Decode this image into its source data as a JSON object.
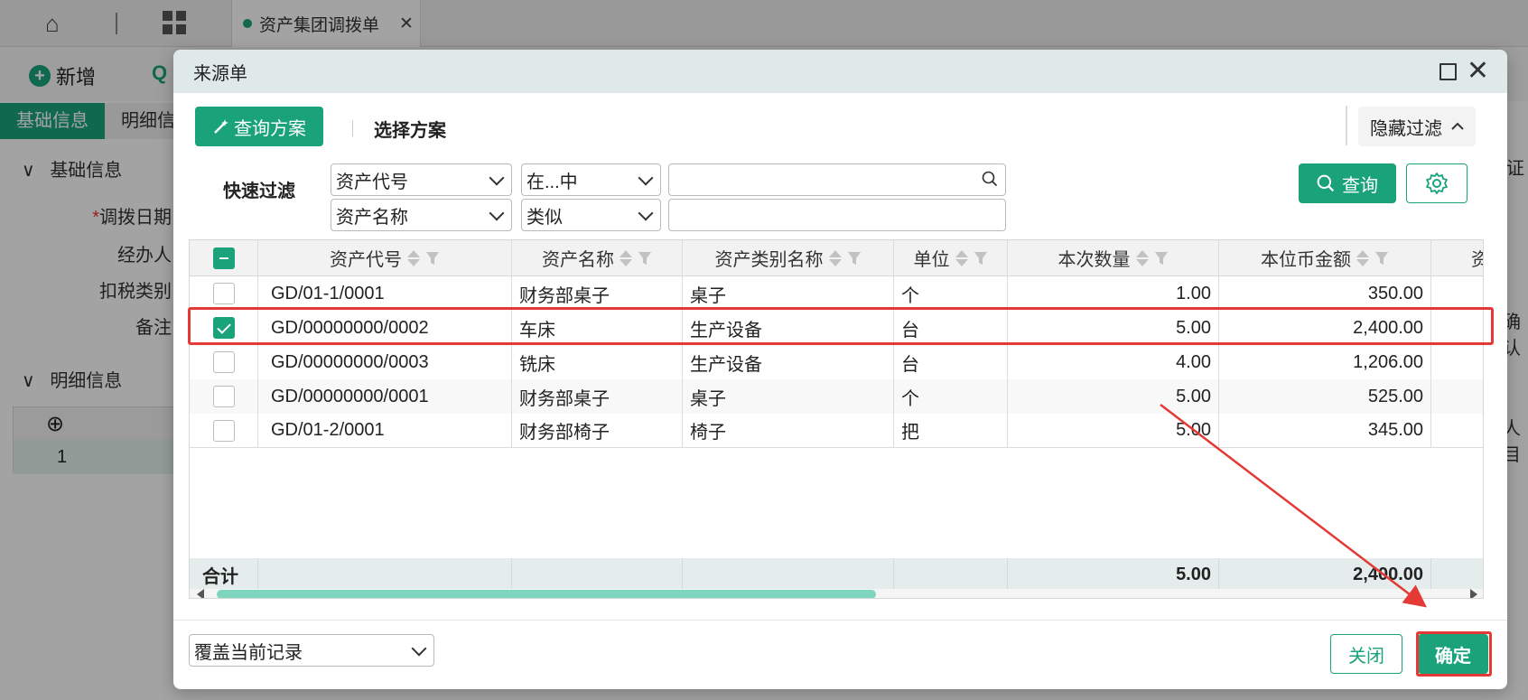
{
  "background": {
    "tab_title": "资产集团调拨单",
    "toolbar": {
      "add_label": "新增"
    },
    "tabs": [
      {
        "label": "基础信息",
        "active": true
      },
      {
        "label": "明细信"
      }
    ],
    "section_basic": "基础信息",
    "section_detail": "明细信息",
    "fields": [
      "调拨日期",
      "经办人",
      "扣税类别",
      "备注"
    ],
    "grid_row_no": "1",
    "right_snippets": [
      "证",
      "确认",
      "人目"
    ]
  },
  "dialog": {
    "title": "来源单",
    "query_plan_label": "查询方案",
    "select_plan_label": "选择方案",
    "hide_filter_label": "隐藏过滤",
    "quick_filter_label": "快速过滤",
    "filters": [
      {
        "field": "资产代号",
        "operator": "在...中",
        "value": ""
      },
      {
        "field": "资产名称",
        "operator": "类似",
        "value": ""
      }
    ],
    "query_button": "查询",
    "table": {
      "columns": [
        "资产代号",
        "资产名称",
        "资产类别名称",
        "单位",
        "本次数量",
        "本位币金额",
        "资"
      ],
      "rows": [
        {
          "checked": false,
          "code": "GD/01-1/0001",
          "name": "财务部桌子",
          "category": "桌子",
          "unit": "个",
          "qty": "1.00",
          "amount": "350.00"
        },
        {
          "checked": true,
          "code": "GD/00000000/0002",
          "name": "车床",
          "category": "生产设备",
          "unit": "台",
          "qty": "5.00",
          "amount": "2,400.00"
        },
        {
          "checked": false,
          "code": "GD/00000000/0003",
          "name": "铣床",
          "category": "生产设备",
          "unit": "台",
          "qty": "4.00",
          "amount": "1,206.00"
        },
        {
          "checked": false,
          "code": "GD/00000000/0001",
          "name": "财务部桌子",
          "category": "桌子",
          "unit": "个",
          "qty": "5.00",
          "amount": "525.00"
        },
        {
          "checked": false,
          "code": "GD/01-2/0001",
          "name": "财务部椅子",
          "category": "椅子",
          "unit": "把",
          "qty": "5.00",
          "amount": "345.00"
        }
      ],
      "footer": {
        "label": "合计",
        "qty": "5.00",
        "amount": "2,400.00"
      }
    },
    "mode_select": "覆盖当前记录",
    "close_button": "关闭",
    "ok_button": "确定"
  },
  "colors": {
    "accent": "#1aa37a",
    "highlight": "#e53935",
    "header": "#dfe9ea"
  }
}
